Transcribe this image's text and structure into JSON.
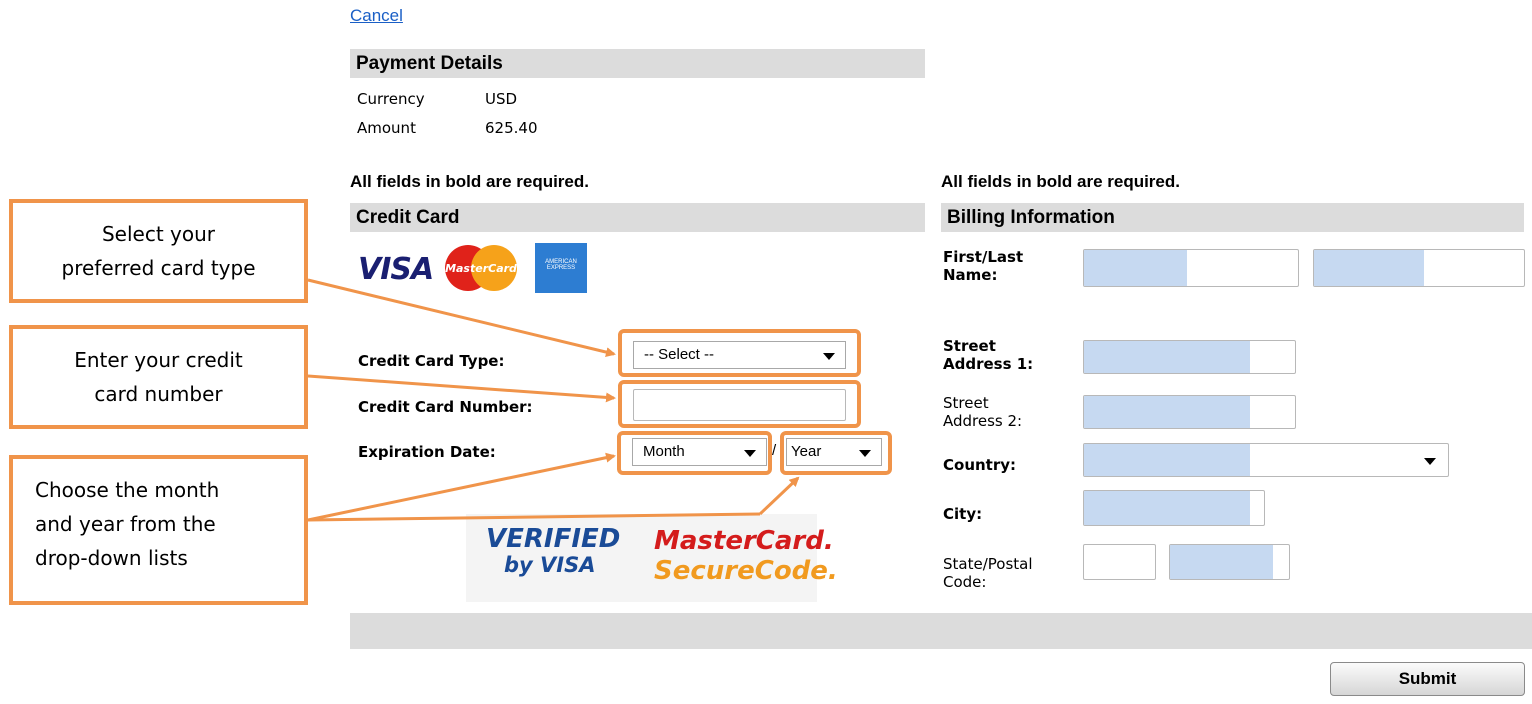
{
  "cancel_label": "Cancel",
  "payment": {
    "title": "Payment Details",
    "currency_label": "Currency",
    "currency_value": "USD",
    "amount_label": "Amount",
    "amount_value": "625.40"
  },
  "required_note": "All fields in bold are required.",
  "credit_card": {
    "title": "Credit Card",
    "logos": {
      "visa": "VISA",
      "mastercard": "MasterCard",
      "amex": "AMERICAN EXPRESS"
    },
    "type_label": "Credit Card Type:",
    "type_selected": "-- Select --",
    "number_label": "Credit Card Number:",
    "number_value": "",
    "expiry_label": "Expiration Date:",
    "month_selected": "Month",
    "year_selected": "Year",
    "expiry_separator": "/",
    "verified_line1": "VERIFIED",
    "verified_line2": "by VISA",
    "securecode_line1": "MasterCard.",
    "securecode_line2": "SecureCode."
  },
  "billing": {
    "title": "Billing Information",
    "name_label_1": "First/Last",
    "name_label_2": "Name:",
    "street1_label_1": "Street",
    "street1_label_2": "Address 1:",
    "street2_label_1": "Street",
    "street2_label_2": "Address 2:",
    "country_label": "Country:",
    "city_label": "City:",
    "state_label_1": "State/Postal",
    "state_label_2": "Code:"
  },
  "callouts": {
    "card_type_1": "Select your",
    "card_type_2": "preferred card type",
    "card_number_1": "Enter your credit",
    "card_number_2": "card number",
    "expiry_1": "Choose the month",
    "expiry_2": "and year from the",
    "expiry_3": "drop-down lists"
  },
  "submit_label": "Submit",
  "colors": {
    "accent_orange": "#f0944a",
    "section_gray": "#dcdcdc",
    "autofill_blue": "#c6d9f1",
    "link_blue": "#1a5fc6"
  }
}
